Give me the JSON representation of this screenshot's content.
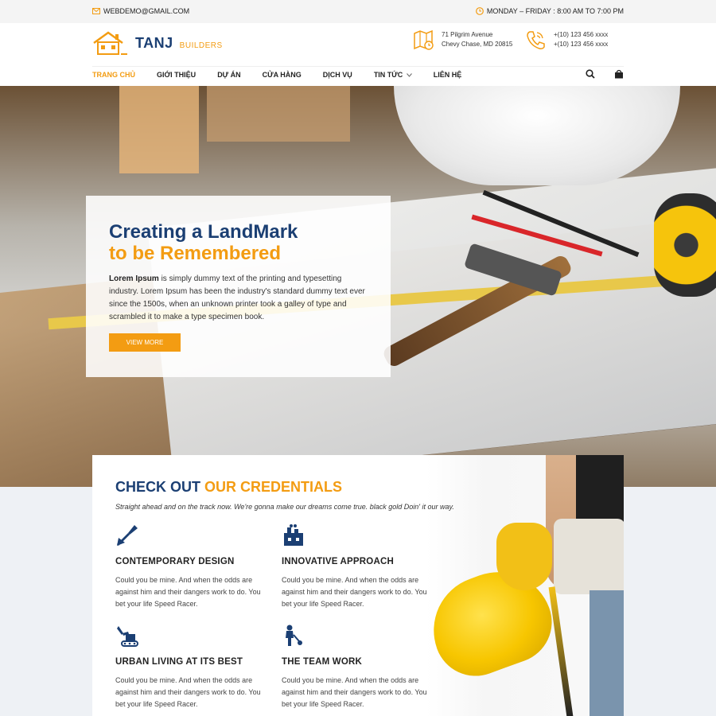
{
  "topbar": {
    "email": "WEBDEMO@GMAIL.COM",
    "hours": "MONDAY – FRIDAY : 8:00 AM TO 7:00 PM"
  },
  "header": {
    "brand": "TANJ",
    "brand_sub": "BUILDERS",
    "address_line1": "71 Pilgrim Avenue",
    "address_line2": "Chevy Chase, MD 20815",
    "phone1": "+(10) 123 456 xxxx",
    "phone2": "+(10) 123 456 xxxx"
  },
  "nav": {
    "items": [
      {
        "label": "TRANG CHỦ"
      },
      {
        "label": "GIỚI THIỆU"
      },
      {
        "label": "DỰ ÁN"
      },
      {
        "label": "CỬA HÀNG"
      },
      {
        "label": "DỊCH VỤ"
      },
      {
        "label": "TIN TỨC"
      },
      {
        "label": "LIÊN HỆ"
      }
    ]
  },
  "hero": {
    "title_line1": "Creating a LandMark",
    "title_line2": "to be Remembered",
    "desc_bold": "Lorem Ipsum",
    "desc_rest": " is simply dummy text of the printing and typesetting industry. Lorem Ipsum has been the industry's standard dummy text ever since the 1500s, when an unknown printer took a galley of type and scrambled it to make a type specimen book.",
    "button": "VIEW MORE"
  },
  "credentials": {
    "title_a": "CHECK OUT ",
    "title_b": "OUR CREDENTIALS",
    "intro": "Straight ahead and on the track now. We're gonna make our dreams come true. black gold Doin' it our way.",
    "features": [
      {
        "title": "CONTEMPORARY DESIGN",
        "desc": "Could you be mine. And when the odds are against him and their dangers work to do. You bet your life Speed Racer."
      },
      {
        "title": "INNOVATIVE APPROACH",
        "desc": "Could you be mine. And when the odds are against him and their dangers work to do. You bet your life Speed Racer."
      },
      {
        "title": "URBAN LIVING AT ITS BEST",
        "desc": "Could you be mine. And when the odds are against him and their dangers work to do. You bet your life Speed Racer."
      },
      {
        "title": "THE TEAM WORK",
        "desc": "Could you be mine. And when the odds are against him and their dangers work to do. You bet your life Speed Racer."
      }
    ]
  },
  "colors": {
    "brand_blue": "#1b3f73",
    "accent_orange": "#f39c12"
  }
}
